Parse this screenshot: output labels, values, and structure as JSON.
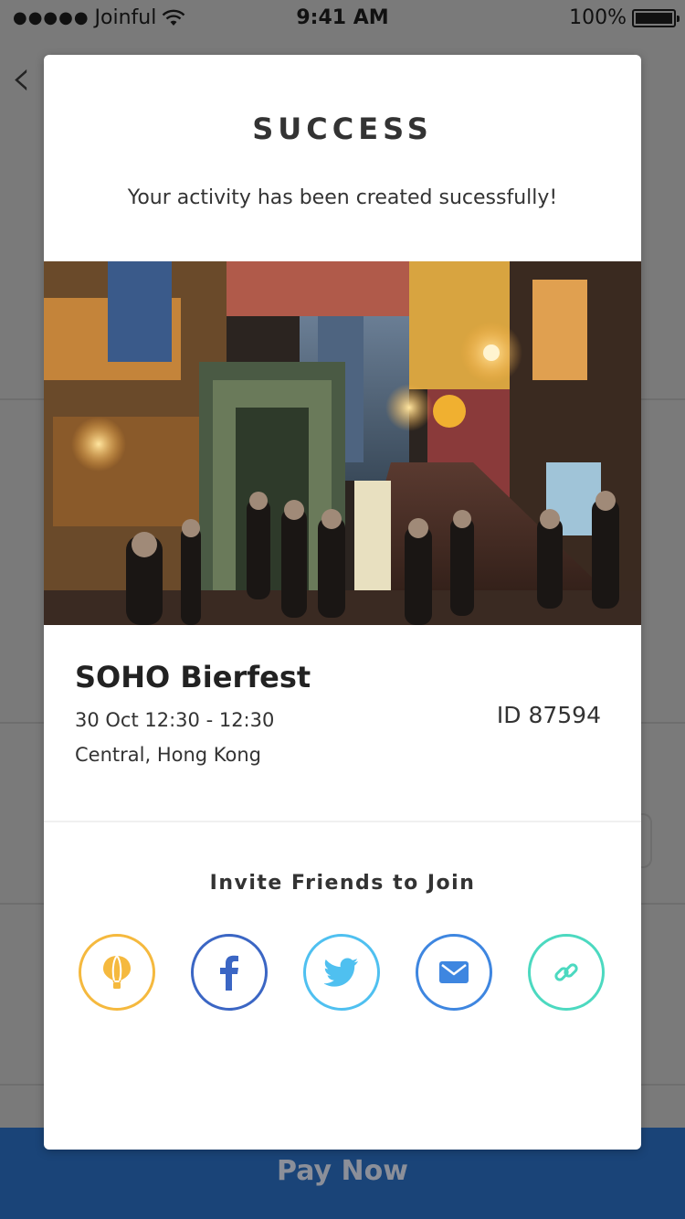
{
  "status_bar": {
    "carrier": "Joinful",
    "time": "9:41 AM",
    "battery": "100%"
  },
  "background": {
    "pay_button_label": "Pay Now"
  },
  "modal": {
    "title": "SUCCESS",
    "message": "Your activity has been created sucessfully!",
    "event": {
      "name": "SOHO Bierfest",
      "time": "30 Oct 12:30 - 12:30",
      "location": "Central, Hong Kong",
      "id": "ID 87594"
    },
    "invite_title": "Invite Friends to Join",
    "share_buttons": [
      {
        "name": "joinful-share-button",
        "icon": "balloon-icon",
        "color": "#F5B93E"
      },
      {
        "name": "facebook-share-button",
        "icon": "facebook-icon",
        "color": "#3B66C4"
      },
      {
        "name": "twitter-share-button",
        "icon": "twitter-icon",
        "color": "#4FC0F0"
      },
      {
        "name": "email-share-button",
        "icon": "mail-icon",
        "color": "#3E86E0"
      },
      {
        "name": "copy-link-button",
        "icon": "link-icon",
        "color": "#4CD9C0"
      }
    ]
  }
}
